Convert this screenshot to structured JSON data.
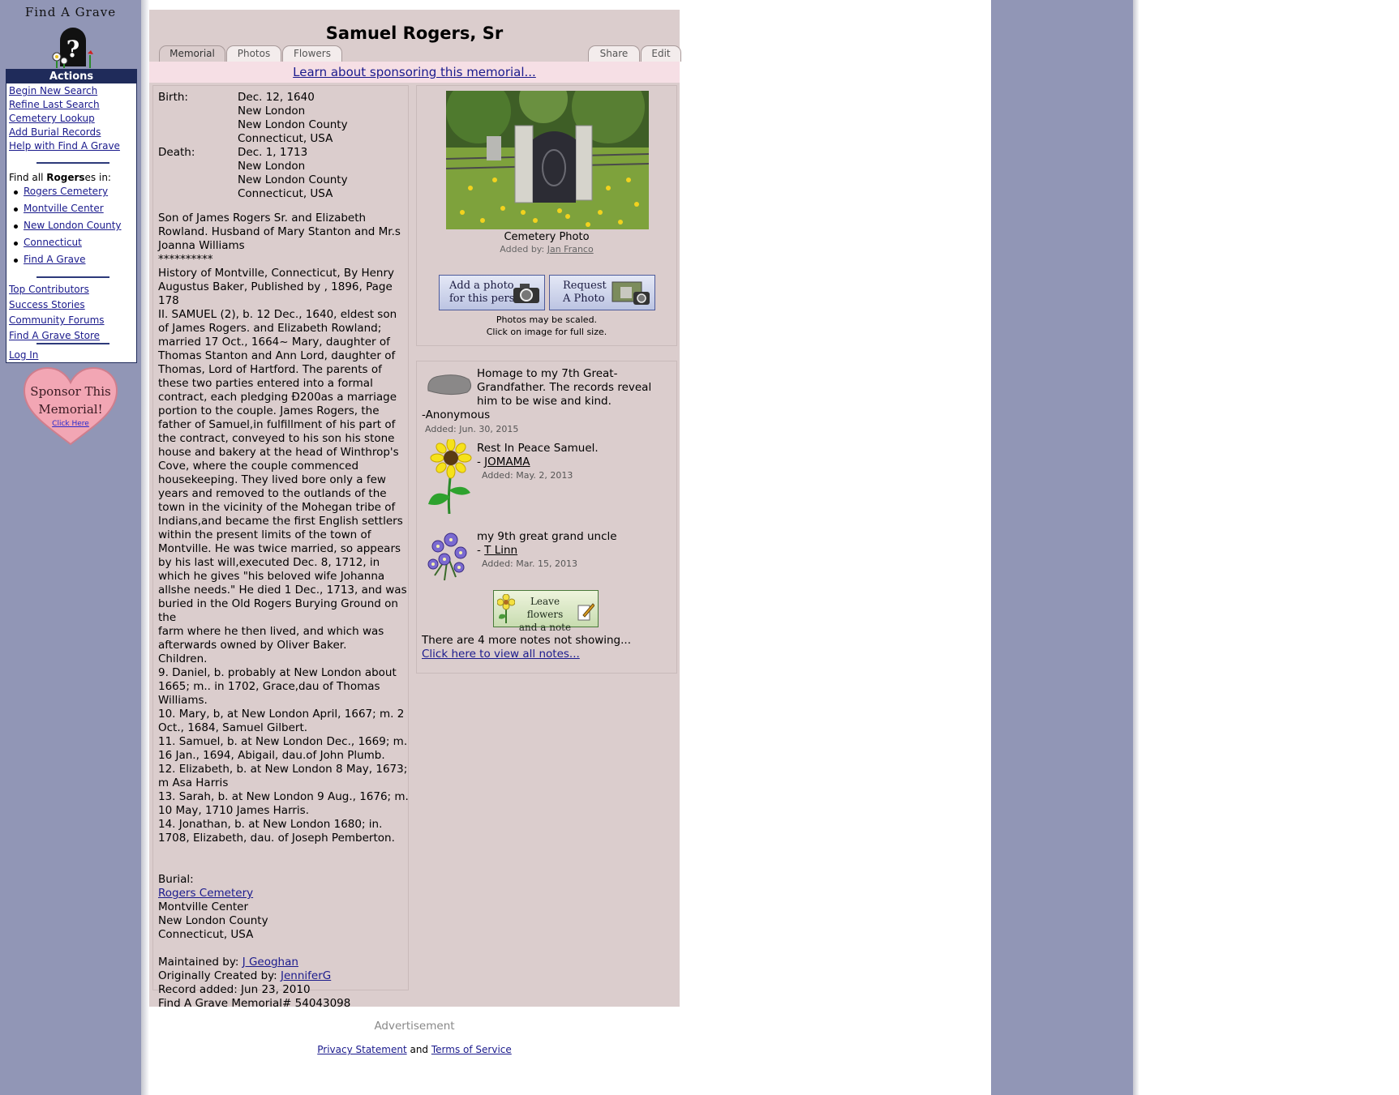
{
  "logo": {
    "text": "Find A Grave"
  },
  "actions": {
    "heading": "Actions",
    "links": [
      "Begin New Search",
      "Refine Last Search",
      "Cemetery Lookup",
      "Add Burial Records",
      "Help with Find A Grave"
    ],
    "find_prefix": "Find all ",
    "find_name": "Rogers",
    "find_suffix": "es in:",
    "places": [
      "Rogers Cemetery",
      "Montville Center",
      "New London County",
      "Connecticut",
      "Find A Grave"
    ],
    "links2": [
      "Top Contributors",
      "Success Stories",
      "Community Forums",
      "Find A Grave Store"
    ],
    "login": "Log In"
  },
  "sponsor_heart": {
    "line1": "Sponsor This",
    "line2": "Memorial!",
    "click": "Click Here"
  },
  "memorial": {
    "name": "Samuel Rogers, Sr",
    "tabs": [
      "Memorial",
      "Photos",
      "Flowers"
    ],
    "right_tabs": [
      "Share",
      "Edit"
    ],
    "sponsor_link": "Learn about sponsoring this memorial...",
    "birth_label": "Birth:",
    "birth_date": "Dec. 12, 1640",
    "birth_place": [
      "New London",
      "New London County",
      "Connecticut, USA"
    ],
    "death_label": "Death:",
    "death_date": "Dec. 1, 1713",
    "death_place": [
      "New London",
      "New London County",
      "Connecticut, USA"
    ],
    "bio": [
      "Son of James Rogers Sr. and Elizabeth",
      "Rowland. Husband of Mary Stanton and Mr.s",
      "Joanna Williams",
      "**********",
      "History of Montville, Connecticut, By Henry",
      "Augustus Baker, Published by , 1896, Page 178",
      "II. SAMUEL (2), b. 12 Dec., 1640, eldest son",
      "of James Rogers. and Elizabeth Rowland;",
      "married 17 Oct., 1664~ Mary, daughter of",
      "Thomas Stanton and Ann Lord, daughter of",
      "Thomas, Lord of Hartford. The parents of",
      "these two parties entered into a formal",
      "contract, each pledging Ð200as a marriage",
      "portion to the couple. James Rogers, the",
      "father of Samuel,in fulfillment of his part of",
      "the contract, conveyed to his son his stone",
      "house and bakery at the head of Winthrop's",
      "Cove, where the couple commenced",
      "housekeeping. They lived bore only a few",
      "years and removed to the outlands of the",
      "town in the vicinity of the Mohegan tribe of",
      "Indians,and became the first English settlers",
      "within the present limits of the town of",
      "Montville. He was twice married, so appears",
      "by his last will,executed Dec. 8, 1712, in",
      "which he gives \"his beloved wife Johanna",
      "allshe needs.\" He died 1 Dec., 1713, and was",
      "buried in the Old Rogers Burying Ground on the",
      "farm where he then lived, and which was",
      "afterwards owned by Oliver Baker.",
      "Children.",
      "9. Daniel, b. probably at New London about",
      "1665; m.. in 1702, Grace,dau of Thomas",
      "Williams.",
      "10. Mary, b, at New London April, 1667; m. 2",
      "Oct., 1684, Samuel Gilbert.",
      "11. Samuel, b. at New London Dec., 1669; m.",
      "16 Jan., 1694, Abigail, dau.of John Plumb.",
      "12. Elizabeth, b. at New London 8 May, 1673;",
      "m Asa Harris",
      "13. Sarah, b. at New London 9 Aug., 1676; m.",
      "10 May, 1710 James Harris.",
      "14. Jonathan, b. at New London 1680; in.",
      "1708, Elizabeth, dau. of Joseph Pemberton."
    ],
    "burial_label": "Burial:",
    "burial_cemetery": "Rogers Cemetery",
    "burial_place": [
      "Montville Center",
      "New London County",
      "Connecticut, USA"
    ],
    "maintained_label": "Maintained by: ",
    "maintained_by": "J Geoghan",
    "created_label": "Originally Created by: ",
    "created_by": "JenniferG",
    "record_added": "Record added: Jun 23, 2010",
    "memorial_id": "Find A Grave Memorial# 54043098"
  },
  "photo": {
    "caption": "Cemetery Photo",
    "added_by_label": "Added by: ",
    "added_by": "Jan Franco",
    "add_btn_l1": "Add a photo",
    "add_btn_l2": "for this person",
    "req_btn_l1": "Request",
    "req_btn_l2": "A Photo",
    "note1": "Photos may be scaled.",
    "note2": "Click on image for full size."
  },
  "notes": [
    {
      "text": "Homage to my 7th Great-Grandfather. The records reveal him to be wise and kind.",
      "author": "-Anonymous",
      "date": "Added: Jun. 30, 2015"
    },
    {
      "text": "Rest In Peace Samuel.",
      "author": "JOMAMA",
      "date": "Added: May. 2, 2013"
    },
    {
      "text": "my 9th great grand uncle",
      "author": "T Linn",
      "date": "Added: Mar. 15, 2013"
    }
  ],
  "flowers": {
    "leave_l1": "Leave flowers",
    "leave_l2": "and a note",
    "more": "There are 4 more notes not showing...",
    "view_all": "Click here to view all notes..."
  },
  "ad": "Advertisement",
  "footer": {
    "privacy": "Privacy Statement",
    "and": " and ",
    "terms": "Terms of Service"
  },
  "colors": {
    "sidebar": "#9196b6",
    "panel": "#dbcdcd",
    "actions_head": "#1f2b5a",
    "sponsor_strip": "#f6dfe5"
  }
}
